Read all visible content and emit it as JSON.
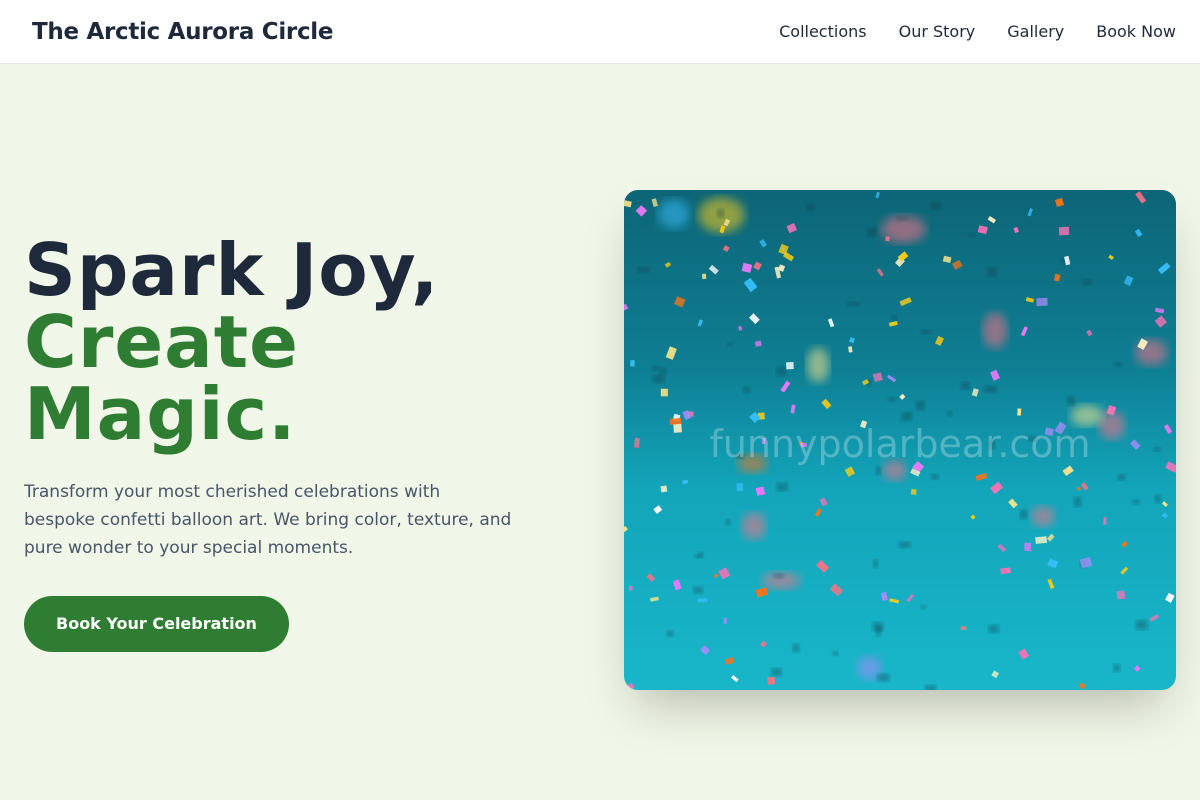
{
  "header": {
    "brand": "The Arctic Aurora Circle",
    "nav": [
      "Collections",
      "Our Story",
      "Gallery",
      "Book Now"
    ]
  },
  "hero": {
    "headline_line1": "Spark Joy,",
    "headline_line2": "Create",
    "headline_line3": "Magic.",
    "subtitle": "Transform your most cherished celebrations with bespoke confetti balloon art. We bring color, texture, and pure wonder to your special moments.",
    "cta_label": "Book Your Celebration",
    "image_watermark": "funnypolarbear.com"
  },
  "colors": {
    "page_bg": "#f1f7e8",
    "primary_text": "#1e293b",
    "accent_green": "#2e7d32",
    "body_text": "#475569"
  }
}
